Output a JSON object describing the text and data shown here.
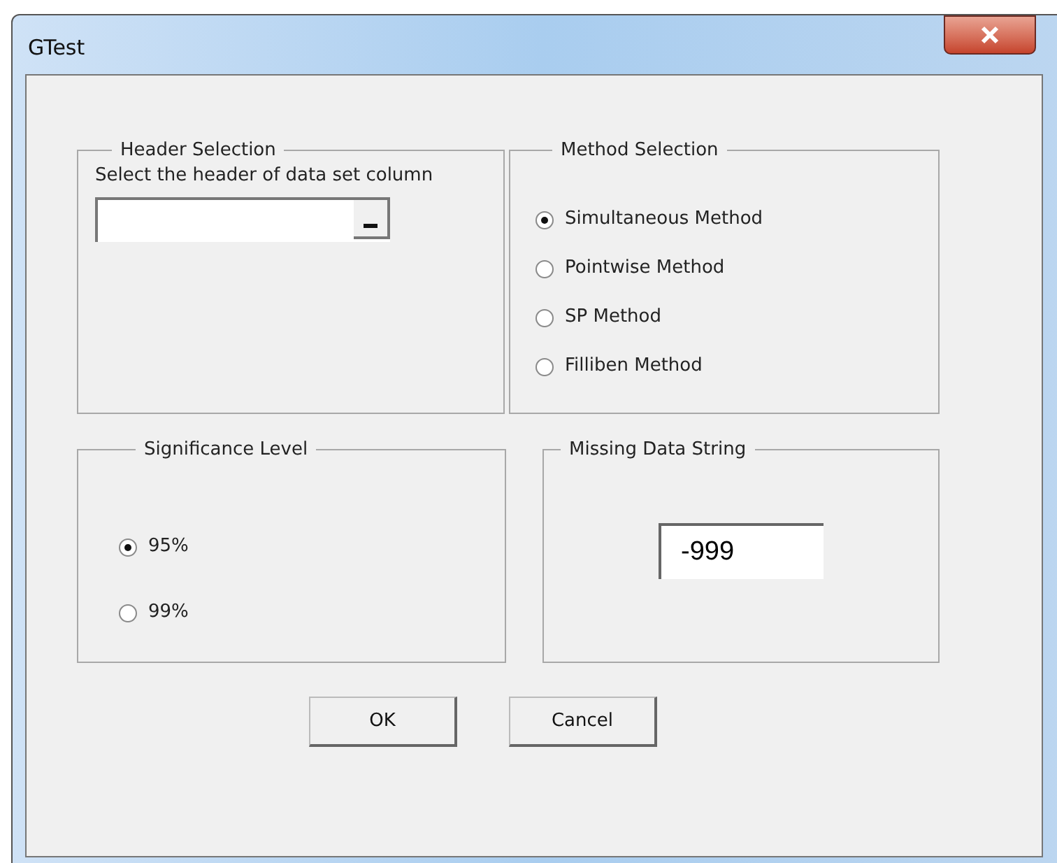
{
  "window": {
    "title": "GTest"
  },
  "header_selection": {
    "title": "Header Selection",
    "label": "Select the header of data set column"
  },
  "method_selection": {
    "title": "Method Selection",
    "options": [
      {
        "label": "Simultaneous Method",
        "selected": true
      },
      {
        "label": "Pointwise Method",
        "selected": false
      },
      {
        "label": "SP Method",
        "selected": false
      },
      {
        "label": "Filliben Method",
        "selected": false
      }
    ]
  },
  "significance_level": {
    "title": "Significance Level",
    "options": [
      {
        "label": "95%",
        "selected": true
      },
      {
        "label": "99%",
        "selected": false
      }
    ]
  },
  "missing_data_string": {
    "title": "Missing Data String",
    "value": "-999"
  },
  "buttons": [
    "OK",
    "Cancel"
  ]
}
